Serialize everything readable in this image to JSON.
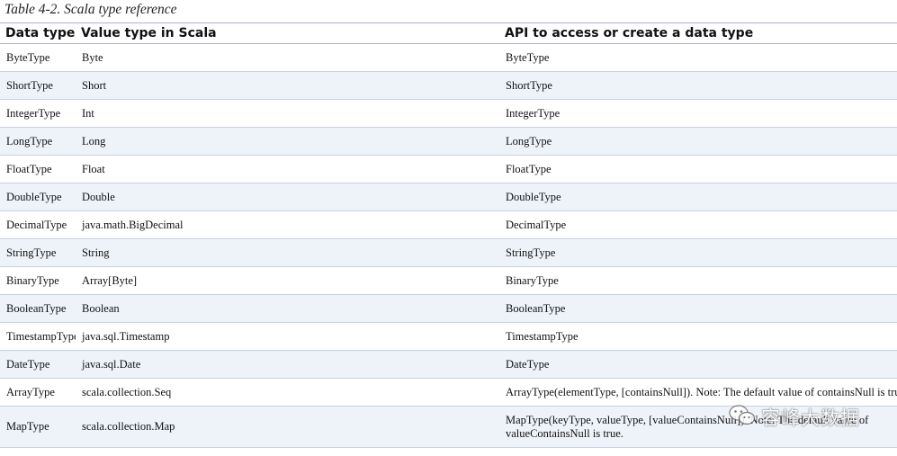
{
  "caption": "Table 4-2. Scala type reference",
  "headers": [
    "Data type",
    "Value type in Scala",
    "API to access or create a data type"
  ],
  "rows": [
    {
      "data_type": "ByteType",
      "scala_type": "Byte",
      "api": "ByteType"
    },
    {
      "data_type": "ShortType",
      "scala_type": "Short",
      "api": "ShortType"
    },
    {
      "data_type": "IntegerType",
      "scala_type": "Int",
      "api": "IntegerType"
    },
    {
      "data_type": "LongType",
      "scala_type": "Long",
      "api": "LongType"
    },
    {
      "data_type": "FloatType",
      "scala_type": "Float",
      "api": "FloatType"
    },
    {
      "data_type": "DoubleType",
      "scala_type": "Double",
      "api": "DoubleType"
    },
    {
      "data_type": "DecimalType",
      "scala_type": "java.math.BigDecimal",
      "api": "DecimalType"
    },
    {
      "data_type": "StringType",
      "scala_type": "String",
      "api": "StringType"
    },
    {
      "data_type": "BinaryType",
      "scala_type": "Array[Byte]",
      "api": "BinaryType"
    },
    {
      "data_type": "BooleanType",
      "scala_type": "Boolean",
      "api": "BooleanType"
    },
    {
      "data_type": "TimestampType",
      "scala_type": "java.sql.Timestamp",
      "api": "TimestampType"
    },
    {
      "data_type": "DateType",
      "scala_type": "java.sql.Date",
      "api": "DateType"
    },
    {
      "data_type": "ArrayType",
      "scala_type": "scala.collection.Seq",
      "api": "ArrayType(elementType, [containsNull]). Note: The default value of containsNull is true."
    },
    {
      "data_type": "MapType",
      "scala_type": "scala.collection.Map",
      "api": "MapType(keyType, valueType, [valueContainsNull]). Note: The default value of valueContainsNull is true."
    }
  ],
  "watermark": {
    "icon": "wechat-icon",
    "text": "容峰大数据"
  },
  "colors": {
    "row_alt": "#eef3fa",
    "border": "#c9d1dd"
  }
}
